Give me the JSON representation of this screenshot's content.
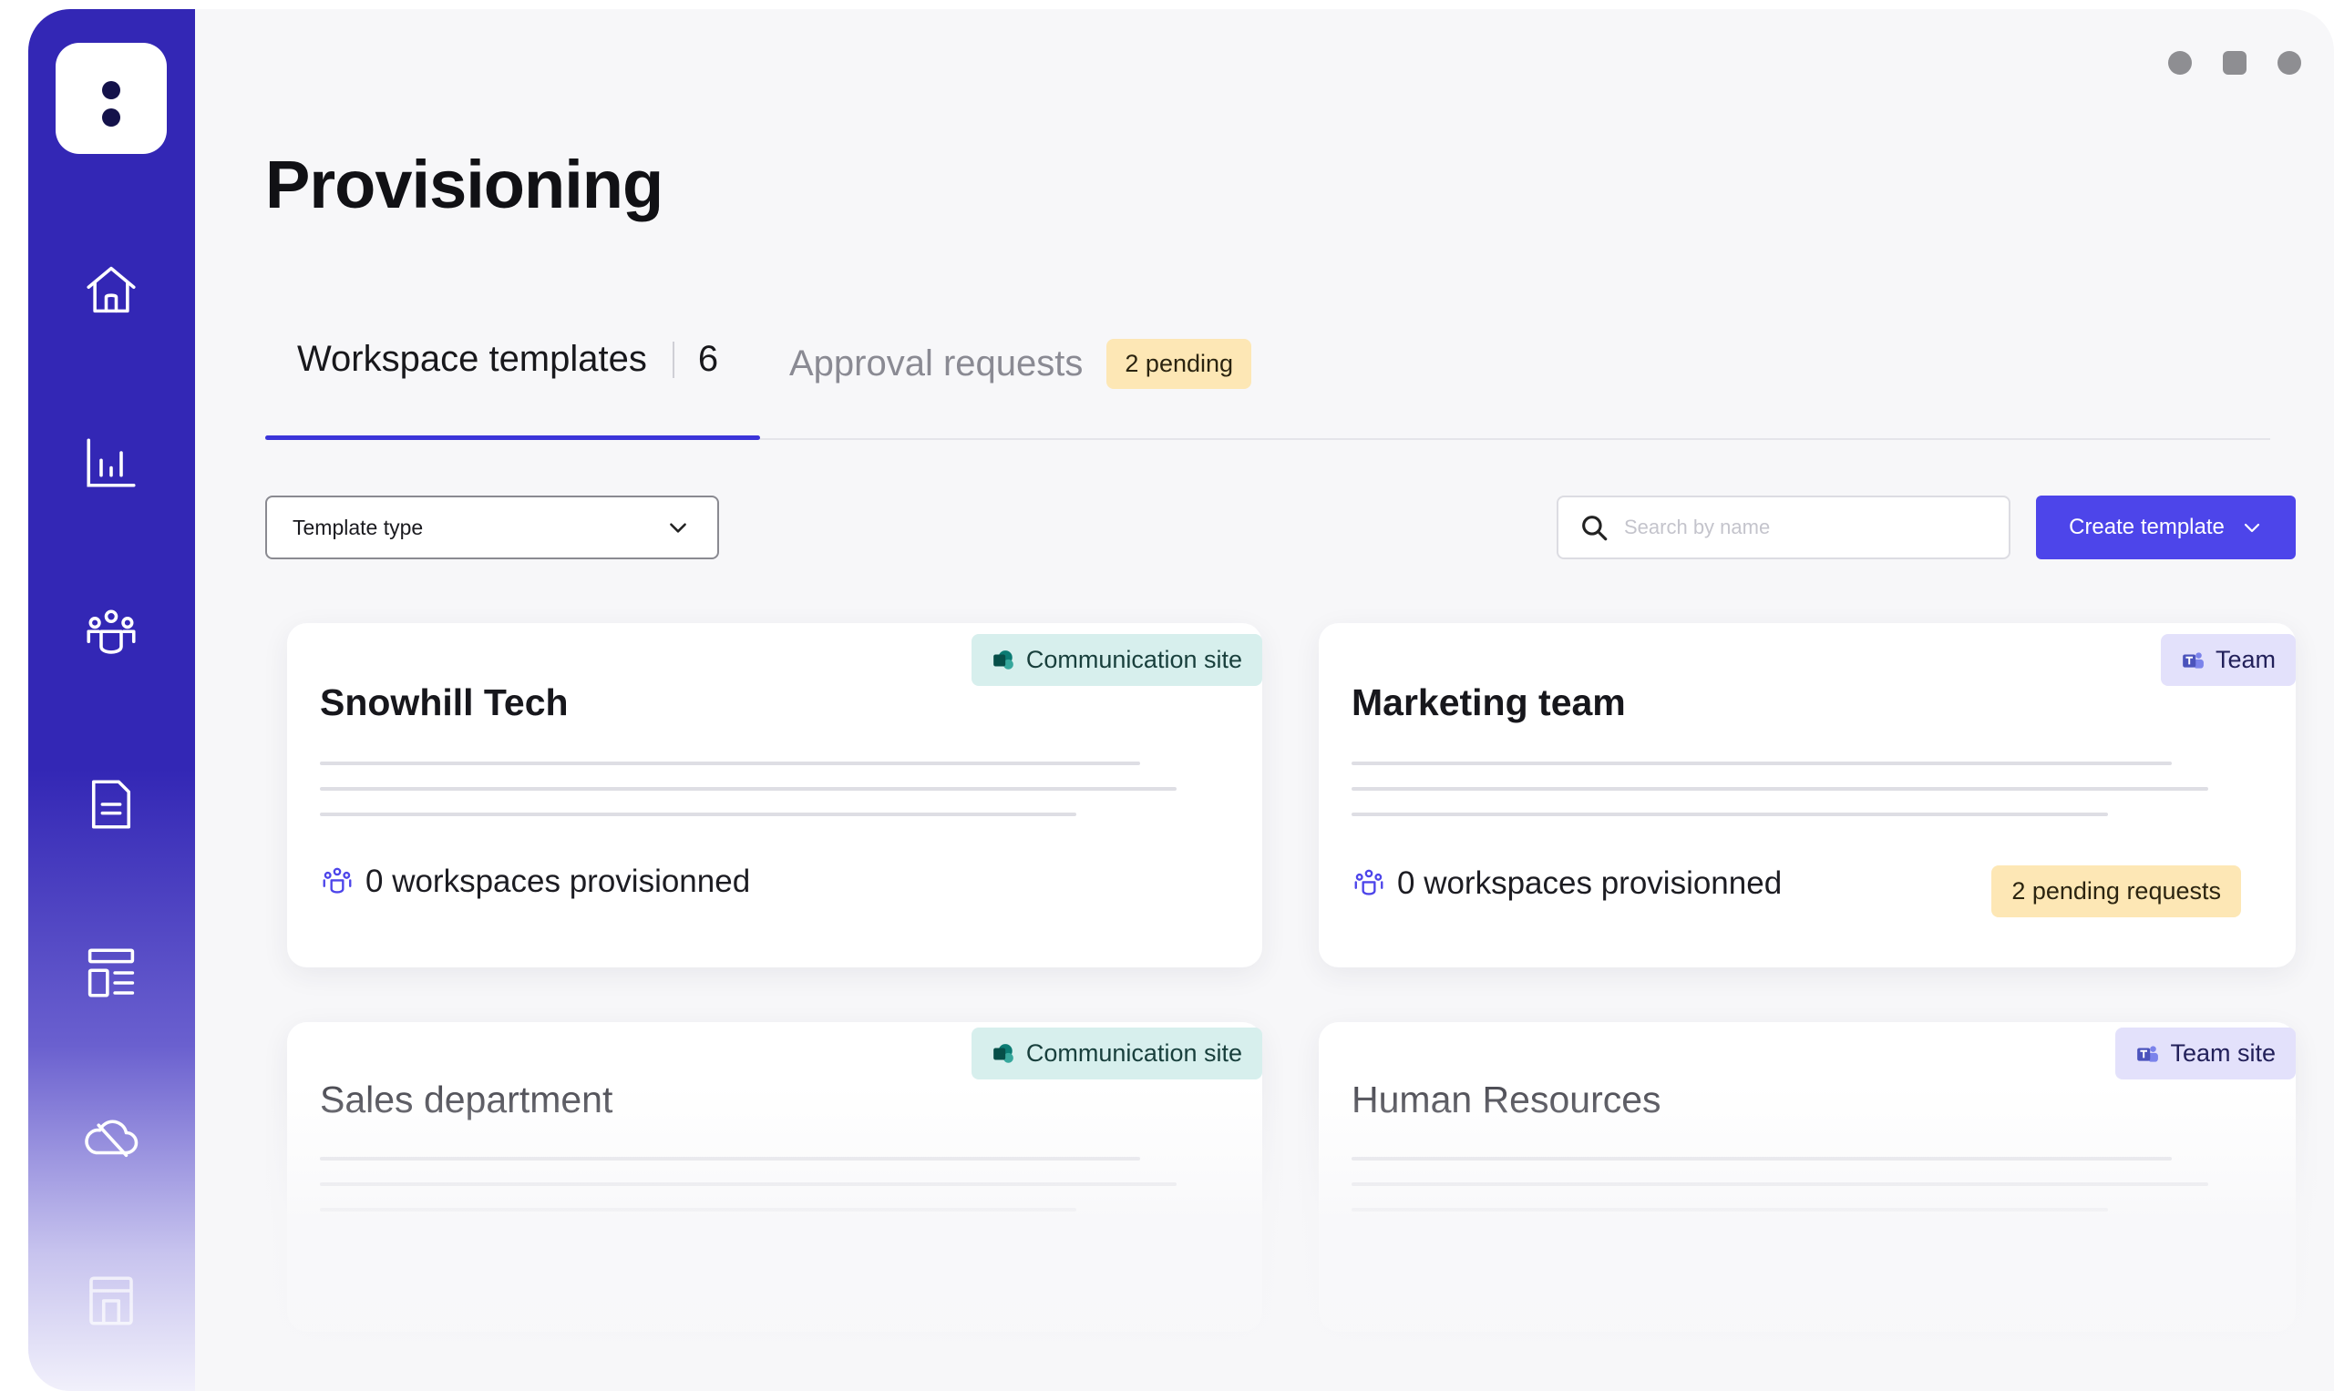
{
  "page": {
    "title": "Provisioning"
  },
  "tabs": [
    {
      "label": "Workspace templates",
      "count": "6"
    },
    {
      "label": "Approval requests",
      "badge": "2 pending"
    }
  ],
  "filters": {
    "template_type": {
      "value": "Template type"
    },
    "search": {
      "placeholder": "Search by name"
    }
  },
  "actions": {
    "create_label": "Create template"
  },
  "cards": [
    {
      "title": "Snowhill Tech",
      "tag": "Communication site",
      "stat": "0 workspaces provisionned"
    },
    {
      "title": "Marketing team",
      "tag": "Team",
      "stat": "0 workspaces provisionned",
      "badge": "2 pending requests"
    },
    {
      "title": "Sales department",
      "tag": "Communication site"
    },
    {
      "title": "Human Resources",
      "tag": "Team site"
    }
  ],
  "colors": {
    "sidebar": "#3327b5",
    "primary": "#4d45ea",
    "pending_badge": "#fde7b5",
    "communication_tag": "#d7efed",
    "team_tag": "#e3e1fb"
  },
  "icons": {
    "sidebar": [
      "app-logo",
      "home-icon",
      "analytics-icon",
      "people-icon",
      "document-icon",
      "template-icon",
      "cloud-icon",
      "archive-icon"
    ]
  }
}
